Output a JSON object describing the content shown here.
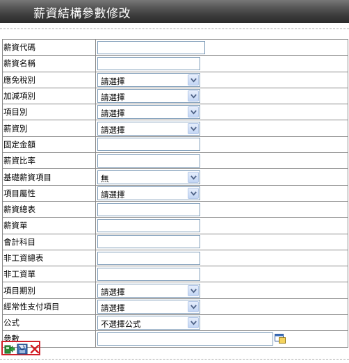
{
  "page": {
    "title": "薪資結構參數修改"
  },
  "form": {
    "rows": [
      {
        "label": "薪資代碼",
        "type": "text",
        "value": "",
        "wide": true
      },
      {
        "label": "薪資名稱",
        "type": "text",
        "value": ""
      },
      {
        "label": "應免稅別",
        "type": "select",
        "value": "請選擇"
      },
      {
        "label": "加減項別",
        "type": "select",
        "value": "請選擇"
      },
      {
        "label": "項目別",
        "type": "select",
        "value": "請選擇"
      },
      {
        "label": "薪資別",
        "type": "select",
        "value": "請選擇"
      },
      {
        "label": "固定金額",
        "type": "text",
        "value": ""
      },
      {
        "label": "薪資比率",
        "type": "text",
        "value": ""
      },
      {
        "label": "基礎薪資項目",
        "type": "select",
        "value": "無"
      },
      {
        "label": "項目屬性",
        "type": "select",
        "value": "請選擇"
      },
      {
        "label": "薪資總表",
        "type": "text",
        "value": ""
      },
      {
        "label": "薪資單",
        "type": "text",
        "value": ""
      },
      {
        "label": "會計科目",
        "type": "text",
        "value": ""
      },
      {
        "label": "非工資總表",
        "type": "text",
        "value": ""
      },
      {
        "label": "非工資單",
        "type": "text",
        "value": ""
      },
      {
        "label": "項目期別",
        "type": "select",
        "value": "請選擇"
      },
      {
        "label": "經常性支付項目",
        "type": "select",
        "value": "請選擇"
      },
      {
        "label": "公式",
        "type": "select",
        "value": "不選擇公式"
      },
      {
        "label": "參數",
        "type": "param",
        "value": ""
      }
    ]
  },
  "actions": {
    "save_icon": "save-icon",
    "reset_icon": "reset-icon",
    "cancel_icon": "cancel-icon"
  }
}
